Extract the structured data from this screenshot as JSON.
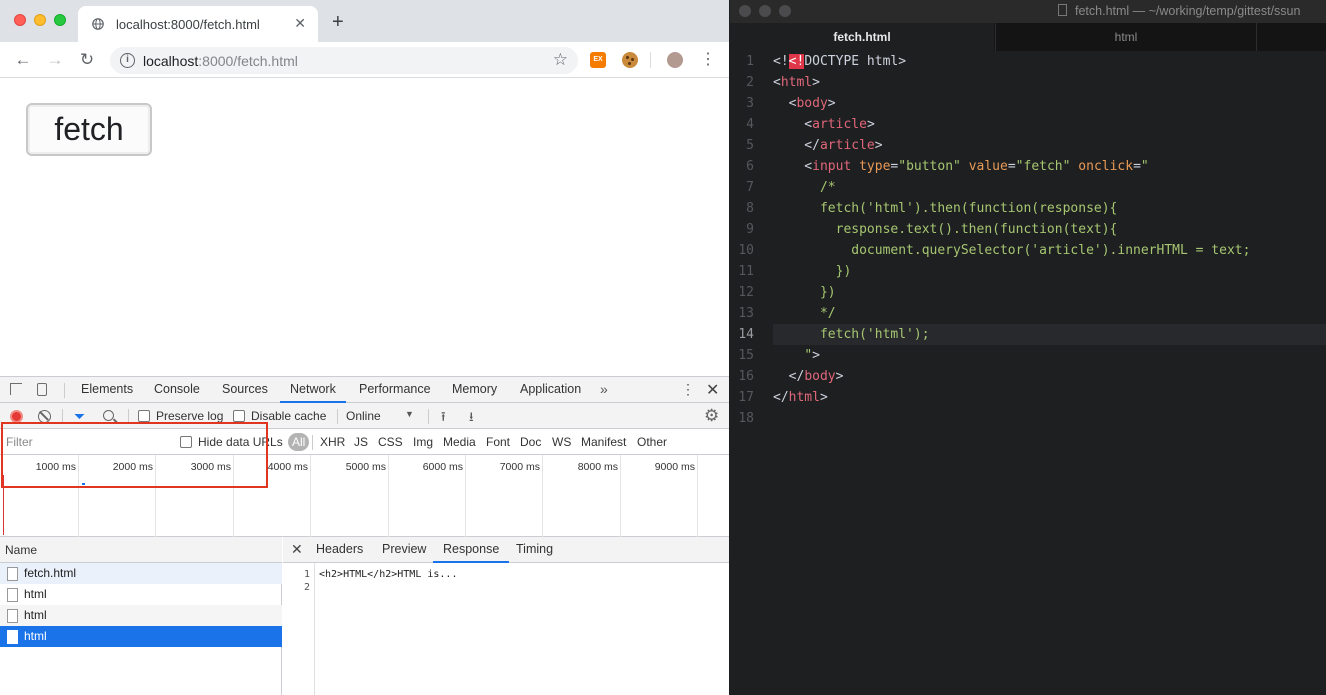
{
  "browser": {
    "tab_title": "localhost:8000/fetch.html",
    "tab_close": "✕",
    "new_tab": "+",
    "url_host": "localhost",
    "url_rest": ":8000/fetch.html",
    "ext_label": "EX",
    "page_button_label": "fetch"
  },
  "devtools": {
    "tabs": [
      "Elements",
      "Console",
      "Sources",
      "Network",
      "Performance",
      "Memory",
      "Application"
    ],
    "active_tab": "Network",
    "more": "»",
    "kebab": "⋮",
    "close": "✕",
    "preserve_log": "Preserve log",
    "disable_cache": "Disable cache",
    "throttle": "Online",
    "filter_placeholder": "Filter",
    "hide_data_urls": "Hide data URLs",
    "types": [
      "All",
      "XHR",
      "JS",
      "CSS",
      "Img",
      "Media",
      "Font",
      "Doc",
      "WS",
      "Manifest",
      "Other"
    ],
    "timeline_labels": [
      "1000 ms",
      "2000 ms",
      "3000 ms",
      "4000 ms",
      "5000 ms",
      "6000 ms",
      "7000 ms",
      "8000 ms",
      "9000 ms"
    ],
    "name_header": "Name",
    "requests": [
      "fetch.html",
      "html",
      "html",
      "html"
    ],
    "selected_request": 3,
    "detail_tabs": [
      "Headers",
      "Preview",
      "Response",
      "Timing"
    ],
    "active_detail_tab": "Response",
    "response_lines": [
      "<h2>HTML</h2>HTML is...",
      ""
    ]
  },
  "editor": {
    "window_title": "fetch.html — ~/working/temp/gittest/ssun",
    "tabs": [
      "fetch.html",
      "html"
    ],
    "active_tab": "fetch.html",
    "current_line": 14,
    "line_numbers": [
      "1",
      "2",
      "3",
      "4",
      "5",
      "6",
      "7",
      "8",
      "9",
      "10",
      "11",
      "12",
      "13",
      "14",
      "15",
      "16",
      "17",
      "18"
    ]
  },
  "colors": {
    "accent_blue": "#1a73e8",
    "record_red": "#e53935",
    "highlight_red": "#e0351f",
    "code_tag": "#e0677a",
    "code_attr": "#e89a56",
    "code_string": "#a6c671"
  }
}
